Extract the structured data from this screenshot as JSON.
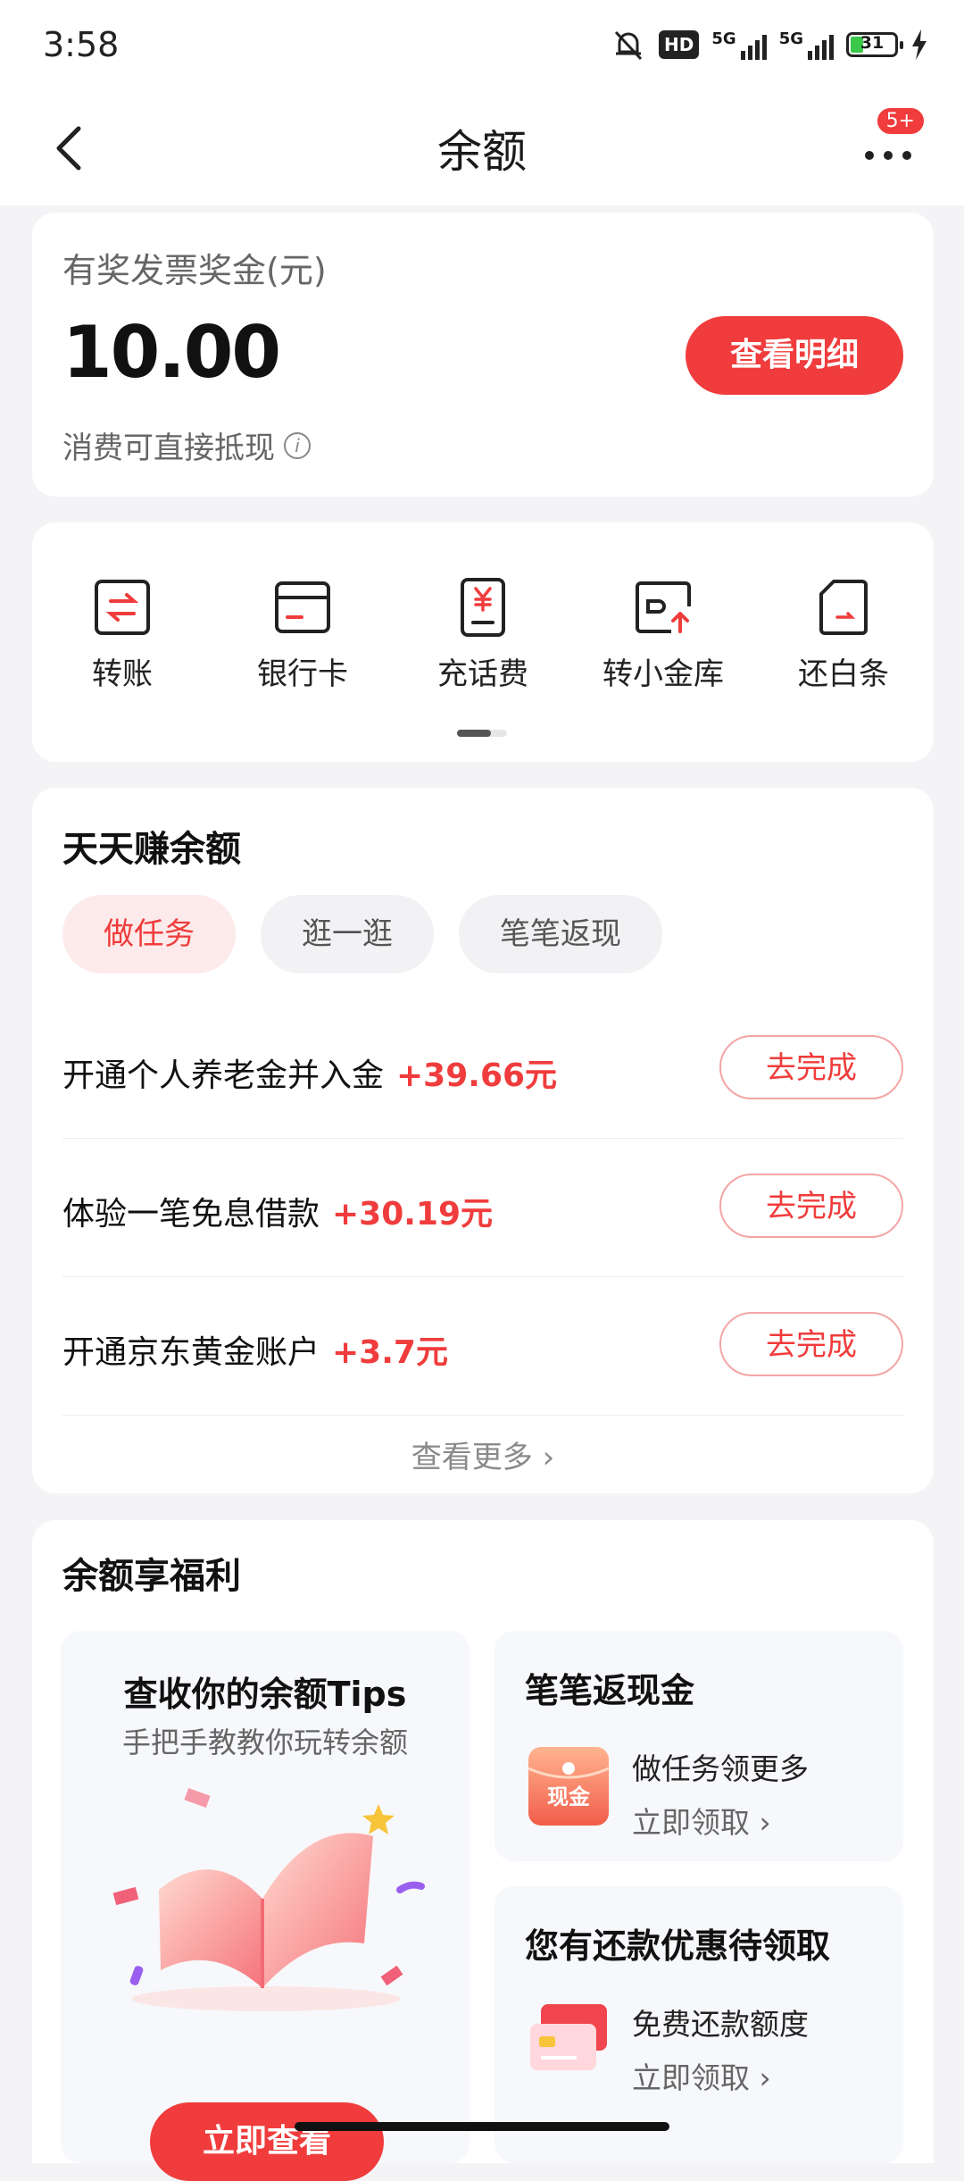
{
  "status_bar": {
    "time": "3:58",
    "network1": "5G",
    "network2": "5G",
    "hd_label": "HD",
    "battery": "31"
  },
  "header": {
    "title": "余额",
    "badge": "5+"
  },
  "balance": {
    "label": "有奖发票奖金(元)",
    "amount": "10.00",
    "detail_button": "查看明细",
    "note": "消费可直接抵现"
  },
  "shortcuts": [
    {
      "label": "转账",
      "icon": "transfer-icon"
    },
    {
      "label": "银行卡",
      "icon": "bank-card-icon"
    },
    {
      "label": "充话费",
      "icon": "phone-recharge-icon"
    },
    {
      "label": "转小金库",
      "icon": "vault-transfer-icon"
    },
    {
      "label": "还白条",
      "icon": "repay-baitiao-icon"
    }
  ],
  "earn": {
    "title": "天天赚余额",
    "tabs": [
      "做任务",
      "逛一逛",
      "笔笔返现"
    ],
    "tasks": [
      {
        "name": "开通个人养老金并入金",
        "reward": "+39.66元",
        "button": "去完成"
      },
      {
        "name": "体验一笔免息借款",
        "reward": "+30.19元",
        "button": "去完成"
      },
      {
        "name": "开通京东黄金账户",
        "reward": "+3.7元",
        "button": "去完成"
      }
    ],
    "see_more": "查看更多"
  },
  "welfare": {
    "title": "余额享福利",
    "left": {
      "title": "查收你的余额Tips",
      "subtitle": "手把手教教你玩转余额",
      "button": "立即查看"
    },
    "cashback": {
      "title": "笔笔返现金",
      "icon_text": "现金",
      "line1": "做任务领更多",
      "line2": "立即领取"
    },
    "repay": {
      "title": "您有还款优惠待领取",
      "line1": "免费还款额度",
      "line2": "立即领取"
    }
  },
  "colors": {
    "accent": "#f03c3c",
    "background": "#f4f4f7"
  }
}
